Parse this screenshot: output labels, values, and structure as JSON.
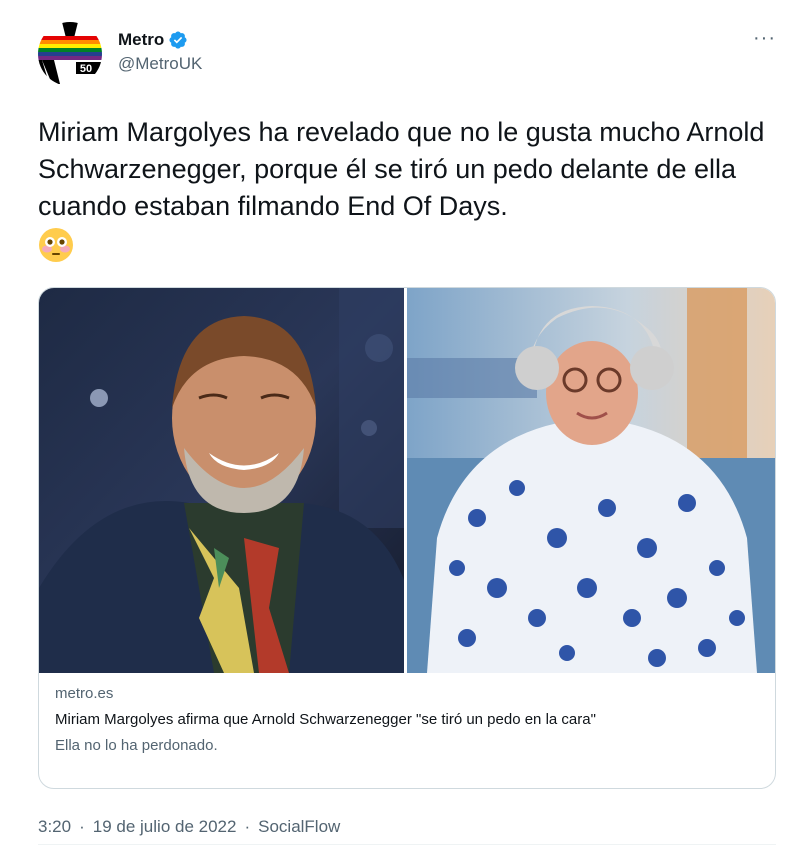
{
  "account": {
    "display_name": "Metro",
    "handle": "@MetroUK",
    "avatar_badge": "50",
    "verified": true
  },
  "tweet": {
    "text": "Miriam Margolyes ha revelado que no le gusta mucho Arnold Schwarzenegger, porque él se tiró un pedo delante de ella cuando estaban filmando End Of Days.",
    "emoji": "flushed-face",
    "time": "3:20",
    "date": "19 de julio de 2022",
    "source": "SocialFlow",
    "separator": "·"
  },
  "card": {
    "domain": "metro.es",
    "title": "Miriam Margolyes afirma que Arnold Schwarzenegger \"se tiró un pedo en la cara\"",
    "description": "Ella no lo ha perdonado."
  },
  "icons": {
    "more": "more-icon",
    "verified": "verified-badge-icon"
  },
  "colors": {
    "text": "#0f1419",
    "secondary": "#536471",
    "verified": "#1d9bf0",
    "border": "#cfd9de"
  }
}
